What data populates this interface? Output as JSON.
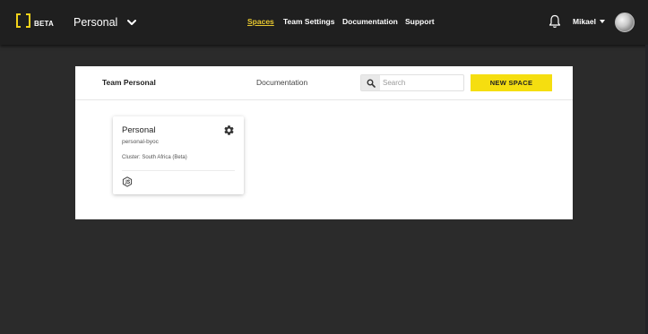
{
  "header": {
    "logo_badge": "BETA",
    "team_name": "Personal",
    "nav": [
      {
        "label": "Spaces",
        "active": true
      },
      {
        "label": "Team Settings",
        "active": false
      },
      {
        "label": "Documentation",
        "active": false
      },
      {
        "label": "Support",
        "active": false
      }
    ],
    "user_name": "Mikael",
    "icons": {
      "notifications": "bell-icon",
      "team_dropdown": "chevron-down-icon",
      "user_dropdown": "caret-down-icon"
    }
  },
  "panel": {
    "team_label": "Team Personal",
    "doc_link": "Documentation",
    "search": {
      "placeholder": "Search",
      "value": ""
    },
    "new_space_label": "NEW SPACE"
  },
  "spaces": [
    {
      "title": "Personal",
      "id": "personal-byoc",
      "cluster": "Cluster: South Africa (Beta)",
      "runtime_icon": "nodejs-icon"
    }
  ],
  "colors": {
    "accent": "#f5de10",
    "active_nav": "#e8c830",
    "background": "#2b2b2b",
    "topbar": "#1f1f1f"
  }
}
